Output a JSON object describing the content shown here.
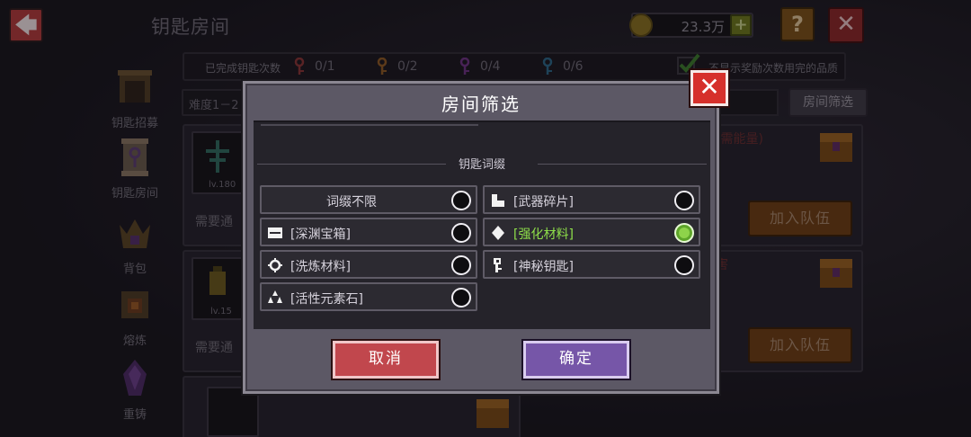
{
  "screen": {
    "title": "钥匙房间",
    "coins": "23.3万",
    "help_label": "?",
    "close_label": "✕",
    "back_label": "🡄"
  },
  "stats": {
    "label": "已完成钥匙次数",
    "keys": [
      {
        "count": "0/1",
        "color": "#b13d3d"
      },
      {
        "count": "0/2",
        "color": "#b36a24"
      },
      {
        "count": "0/4",
        "color": "#8a3fa0"
      },
      {
        "count": "0/6",
        "color": "#2f7fa8"
      }
    ],
    "checkbox_label": "不显示奖励次数用完的品质"
  },
  "side_nav": [
    {
      "label": "钥匙招募",
      "icon": "gate-icon"
    },
    {
      "label": "钥匙房间",
      "icon": "scroll-key-icon"
    },
    {
      "label": "背包",
      "icon": "crown-gem-icon"
    },
    {
      "label": "熔炼",
      "icon": "forge-icon"
    },
    {
      "label": "重铸",
      "icon": "purple-crystal-icon"
    }
  ],
  "toolbar": {
    "difficulty": "难度1－2",
    "filter_button": "房间筛选"
  },
  "rooms": [
    {
      "level": "lv.180",
      "need": "需要通",
      "note": "(需能量)",
      "join": "加入队伍"
    },
    {
      "level": "lv.15",
      "need": "需要通",
      "note": "害",
      "join": "加入队伍"
    }
  ],
  "dialog": {
    "title": "房间筛选",
    "section": "钥匙词缀",
    "close_label": "✕",
    "options": [
      {
        "label": "词缀不限",
        "icon": "none",
        "selected": false
      },
      {
        "label": "[武器碎片]",
        "icon": "weapon-shard-icon",
        "selected": false
      },
      {
        "label": "[深渊宝箱]",
        "icon": "abyss-chest-icon",
        "selected": false
      },
      {
        "label": "[强化材料]",
        "icon": "enhance-material-icon",
        "selected": true
      },
      {
        "label": "[洗炼材料]",
        "icon": "refine-gear-icon",
        "selected": false
      },
      {
        "label": "[神秘钥匙]",
        "icon": "mystery-key-icon",
        "selected": false
      },
      {
        "label": "[活性元素石]",
        "icon": "element-stone-icon",
        "selected": false
      }
    ],
    "cancel_label": "取消",
    "confirm_label": "确定"
  },
  "colors": {
    "active_option": "#8fe04a",
    "cancel_button": "#c1474d",
    "confirm_button": "#7656a8",
    "close_button": "#d6302b"
  }
}
